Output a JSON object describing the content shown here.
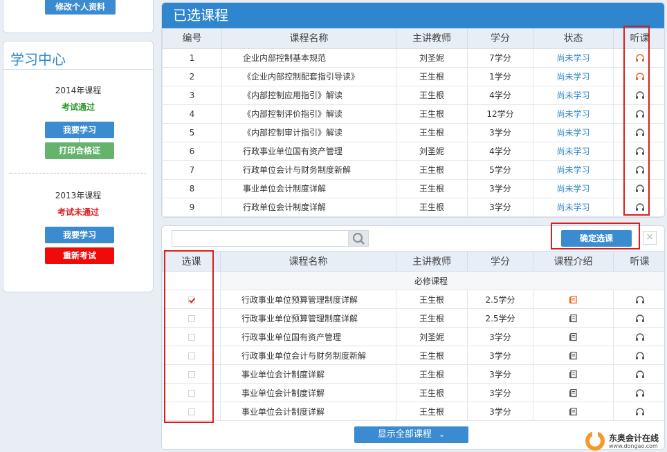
{
  "sidebar": {
    "edit_profile": "修改个人资料",
    "learn_title": "学习中心",
    "blocks": [
      {
        "year": "2014年课程",
        "status": "考试通过",
        "btn1": "我要学习",
        "btn2": "打印合格证"
      },
      {
        "year": "2013年课程",
        "status": "考试未通过",
        "btn1": "我要学习",
        "btn2": "重新考试"
      }
    ]
  },
  "selected": {
    "title": "已选课程",
    "headers": [
      "编号",
      "课程名称",
      "主讲教师",
      "学分",
      "状态",
      "听课"
    ],
    "rows": [
      {
        "no": "1",
        "name": "企业内部控制基本规范",
        "teacher": "刘圣妮",
        "credit": "7学分",
        "status": "尚未学习",
        "icon": "headphones-icon",
        "active": true
      },
      {
        "no": "2",
        "name": "《企业内部控制配套指引导读》",
        "teacher": "王生根",
        "credit": "1学分",
        "status": "尚未学习",
        "icon": "headphones-icon",
        "active": true
      },
      {
        "no": "3",
        "name": "《内部控制应用指引》解读",
        "teacher": "王生根",
        "credit": "4学分",
        "status": "尚未学习",
        "icon": "headphones-icon",
        "active": false
      },
      {
        "no": "4",
        "name": "《内部控制评价指引》解读",
        "teacher": "王生根",
        "credit": "12学分",
        "status": "尚未学习",
        "icon": "headphones-icon",
        "active": false
      },
      {
        "no": "5",
        "name": "《内部控制审计指引》解读",
        "teacher": "王生根",
        "credit": "3学分",
        "status": "尚未学习",
        "icon": "headphones-icon",
        "active": false
      },
      {
        "no": "6",
        "name": "行政事业单位国有资产管理",
        "teacher": "刘圣妮",
        "credit": "4学分",
        "status": "尚未学习",
        "icon": "headphones-icon",
        "active": false
      },
      {
        "no": "7",
        "name": "行政单位会计与财务制度新解",
        "teacher": "王生根",
        "credit": "5学分",
        "status": "尚未学习",
        "icon": "headphones-icon",
        "active": false
      },
      {
        "no": "8",
        "name": "事业单位会计制度详解",
        "teacher": "王生根",
        "credit": "3学分",
        "status": "尚未学习",
        "icon": "headphones-icon",
        "active": false
      },
      {
        "no": "9",
        "name": "行政单位会计制度详解",
        "teacher": "王生根",
        "credit": "3学分",
        "status": "尚未学习",
        "icon": "headphones-icon",
        "active": false
      }
    ]
  },
  "picker": {
    "search_placeholder": "",
    "confirm_label": "确定选课",
    "close_label": "×",
    "headers": [
      "选课",
      "课程名称",
      "主讲教师",
      "学分",
      "课程介绍",
      "听课"
    ],
    "group_label": "必修课程",
    "rows": [
      {
        "checked": true,
        "name": "行政事业单位预算管理制度详解",
        "teacher": "王生根",
        "credit": "2.5学分",
        "intro_active": true
      },
      {
        "checked": false,
        "name": "行政事业单位预算管理制度详解",
        "teacher": "王生根",
        "credit": "2.5学分",
        "intro_active": false
      },
      {
        "checked": false,
        "name": "行政事业单位国有资产管理",
        "teacher": "刘圣妮",
        "credit": "3学分",
        "intro_active": false
      },
      {
        "checked": false,
        "name": "行政事业单位会计与财务制度新解",
        "teacher": "王生根",
        "credit": "3学分",
        "intro_active": false
      },
      {
        "checked": false,
        "name": "事业单位会计制度详解",
        "teacher": "王生根",
        "credit": "3学分",
        "intro_active": false
      },
      {
        "checked": false,
        "name": "事业单位会计制度详解",
        "teacher": "王生根",
        "credit": "3学分",
        "intro_active": false
      },
      {
        "checked": false,
        "name": "事业单位会计制度详解",
        "teacher": "王生根",
        "credit": "3学分",
        "intro_active": false
      }
    ],
    "show_all_label": "显示全部课程"
  },
  "logo": {
    "name": "东奥会计在线",
    "url_text": "www.dongao.com"
  },
  "colors": {
    "accent": "#2f86cf",
    "active_icon": "#e8661e",
    "highlight": "#d81e1e"
  }
}
